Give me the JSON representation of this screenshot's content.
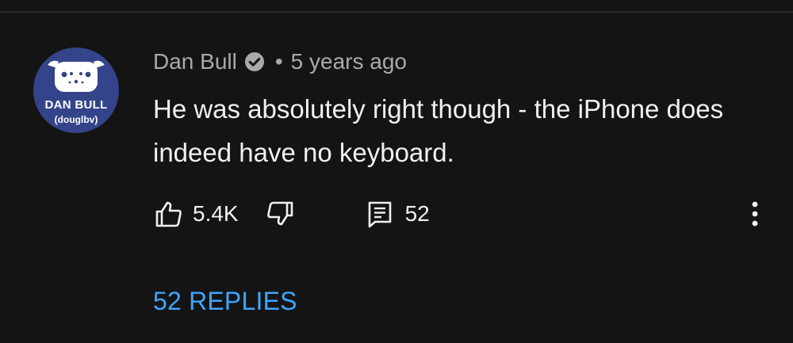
{
  "comment": {
    "author": "Dan Bull",
    "verified_icon": "verified-check-icon",
    "separator": "•",
    "timestamp": "5 years ago",
    "text": "He was absolutely right though - the iPhone does indeed have no keyboard.",
    "avatar": {
      "name": "DAN BULL",
      "handle": "(douglbv)",
      "bg_color": "#33448a"
    }
  },
  "actions": {
    "like_icon": "thumbs-up-icon",
    "like_count": "5.4K",
    "dislike_icon": "thumbs-down-icon",
    "reply_icon": "reply-comment-icon",
    "reply_count": "52",
    "more_icon": "more-vert-icon"
  },
  "replies": {
    "label": "52 REPLIES",
    "color": "#3ea6ff"
  }
}
